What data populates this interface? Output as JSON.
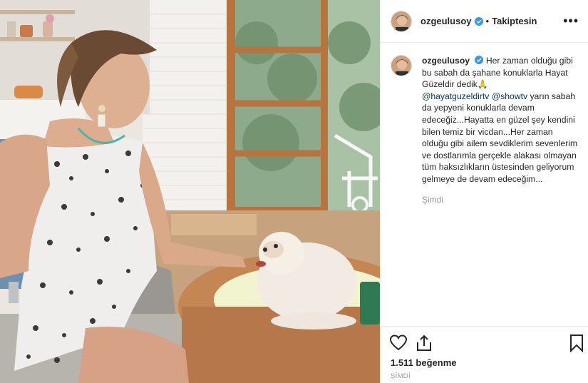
{
  "post": {
    "username": "ozgeulusoy",
    "follow_status": "Takiptesin",
    "separator": "•",
    "more_icon": "more-options-icon",
    "caption": {
      "username": "ozgeulusoy",
      "line1": "Her zaman olduğu gibi bu sabah da şahane konuklarla Hayat Güzeldir dedik🙏",
      "mention1": "@hayatguzeldirtv",
      "mention2": "@showtv",
      "line2": " yarın sabah da yepyeni konuklarla devam edeceğiz...Hayatta en güzel şey kendini bilen temiz bir vicdan...Her zaman olduğu gibi ailem sevdiklerim sevenlerim ve dostlarımla gerçekle alakası olmayan tüm haksızlıkların üstesinden geliyorum gelmeye de devam edeceğim...",
      "time": "Şimdi"
    },
    "likes": "1.511 beğenme",
    "timestamp": "ŞİMDİ",
    "icons": {
      "like": "heart-icon",
      "share": "share-icon",
      "save": "bookmark-icon",
      "verified": "verified-badge-icon"
    },
    "colors": {
      "verified": "#3897f0",
      "mention": "#003569",
      "muted": "#999999",
      "text": "#262626"
    }
  }
}
